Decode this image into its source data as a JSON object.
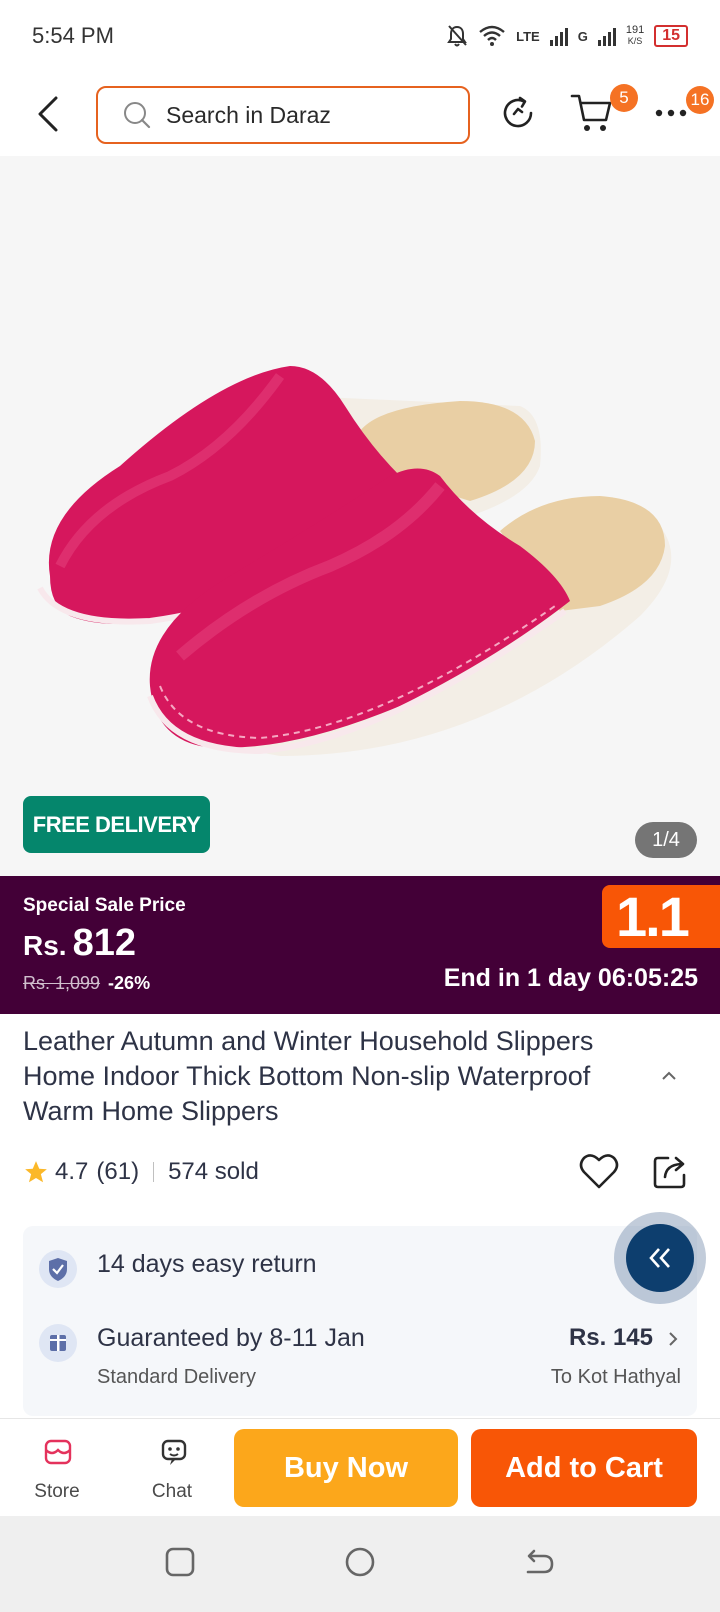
{
  "status_bar": {
    "time": "5:54 PM",
    "network_1": "LTE",
    "network_2": "G",
    "speed": "191",
    "speed_unit": "K/S",
    "battery": "15"
  },
  "header": {
    "search_placeholder": "Search in Daraz",
    "cart_count": "5",
    "more_count": "16"
  },
  "gallery": {
    "free_delivery_label": "FREE DELIVERY",
    "page_indicator": "1/4"
  },
  "sale": {
    "title": "Special Sale Price",
    "currency": "Rs.",
    "price": "812",
    "original_price": "Rs. 1,099",
    "discount": "-26%",
    "campaign_logo": "1.1",
    "countdown": "End in 1 day 06:05:25"
  },
  "product": {
    "title": "Leather Autumn and Winter Household Slippers Home Indoor Thick Bottom Non-slip Waterproof Warm Home Slippers",
    "rating": "4.7",
    "rating_count": "(61)",
    "sold": "574 sold"
  },
  "service": {
    "return_text": "14 days easy return",
    "guarantee_text": "Guaranteed by 8-11 Jan",
    "delivery_type": "Standard Delivery",
    "delivery_fee": "Rs. 145",
    "destination": "To Kot Hathyal"
  },
  "bottom_bar": {
    "store_label": "Store",
    "chat_label": "Chat",
    "buy_now_label": "Buy Now",
    "add_to_cart_label": "Add to Cart"
  },
  "colors": {
    "brand_orange": "#f85606",
    "buy_now": "#fca71b",
    "sale_banner": "#430037",
    "free_delivery": "#05866c",
    "product_pink": "#d81b60"
  }
}
